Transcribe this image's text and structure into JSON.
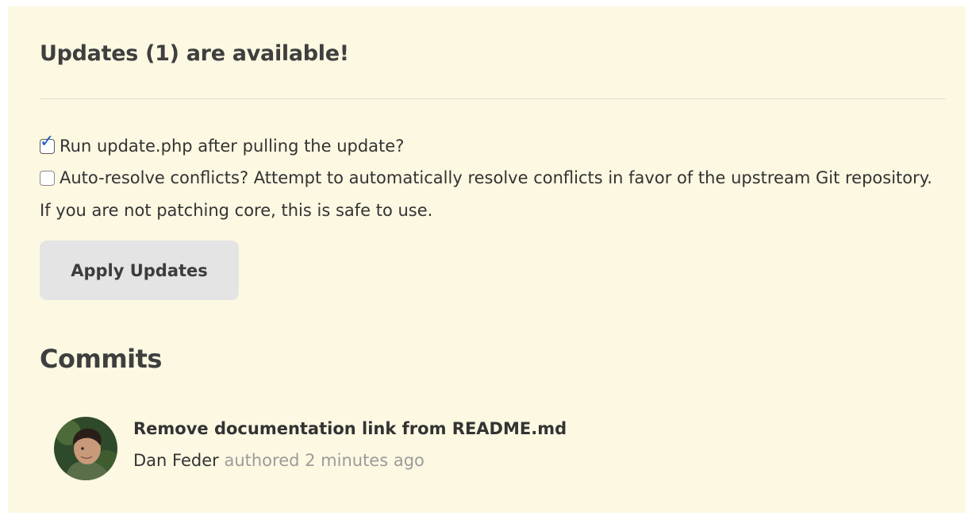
{
  "updates": {
    "heading": "Updates (1) are available!",
    "run_update_label": "Run update.php after pulling the update?",
    "run_update_checked": true,
    "auto_resolve_label": "Auto-resolve conflicts? Attempt to automatically resolve conflicts in favor of the upstream Git repository. If you are not patching core, this is safe to use.",
    "auto_resolve_checked": false,
    "apply_button_label": "Apply Updates"
  },
  "commits": {
    "heading": "Commits",
    "items": [
      {
        "title": "Remove documentation link from README.md",
        "author": "Dan Feder",
        "meta": "authored 2 minutes ago",
        "avatar_icon": "user-avatar-photo"
      }
    ]
  },
  "colors": {
    "panel_background": "#fdf8e2",
    "button_background": "#e4e4e4",
    "muted_text": "#9b9b9b",
    "checkbox_tick": "#1f5fbf"
  }
}
